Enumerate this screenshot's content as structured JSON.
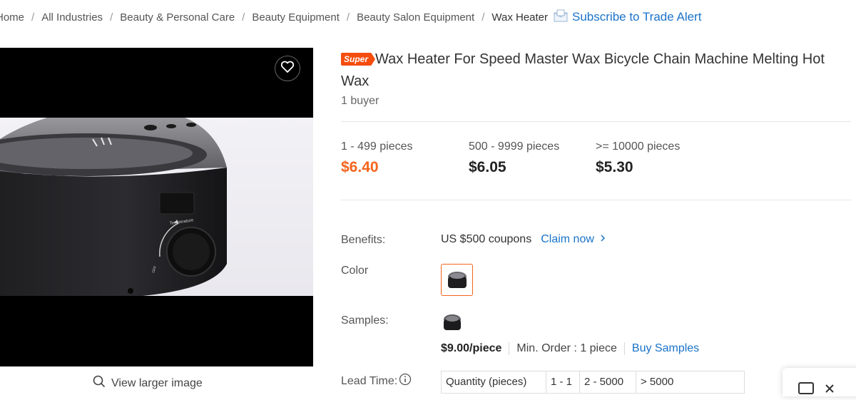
{
  "breadcrumb": {
    "items": [
      "Home",
      "All Industries",
      "Beauty & Personal Care",
      "Beauty Equipment",
      "Beauty Salon Equipment"
    ],
    "current": "Wax Heater",
    "separator": "/",
    "subscribe_label": "Subscribe to Trade Alert"
  },
  "media": {
    "view_larger_label": "View larger image",
    "photo_text": {
      "dial_label": "Temperature",
      "off_label": "OFF"
    }
  },
  "product": {
    "badge": "Super",
    "title": "Wax Heater For Speed Master Wax Bicycle Chain Machine Melting Hot Wax",
    "buyers": "1 buyer"
  },
  "price_tiers": [
    {
      "qty": "1 - 499 pieces",
      "price": "$6.40",
      "active": true
    },
    {
      "qty": "500 - 9999 pieces",
      "price": "$6.05",
      "active": false
    },
    {
      "qty": ">= 10000 pieces",
      "price": "$5.30",
      "active": false
    }
  ],
  "benefits": {
    "label": "Benefits:",
    "coupon": "US $500 coupons",
    "claim": "Claim now"
  },
  "color": {
    "label": "Color"
  },
  "samples": {
    "label": "Samples:",
    "price": "$9.00/piece",
    "min_order": "Min. Order : 1 piece",
    "buy": "Buy Samples"
  },
  "lead_time": {
    "label": "Lead Time:",
    "columns": [
      "Quantity (pieces)",
      "1 - 1",
      "2 - 5000",
      "> 5000"
    ]
  },
  "colors": {
    "accent": "#f4641d",
    "link": "#1a73c9",
    "badge": "#f44d0e"
  },
  "icons": [
    "envelope-icon",
    "heart-icon",
    "search-icon",
    "chevron-right-icon",
    "info-icon",
    "chat-icon"
  ]
}
